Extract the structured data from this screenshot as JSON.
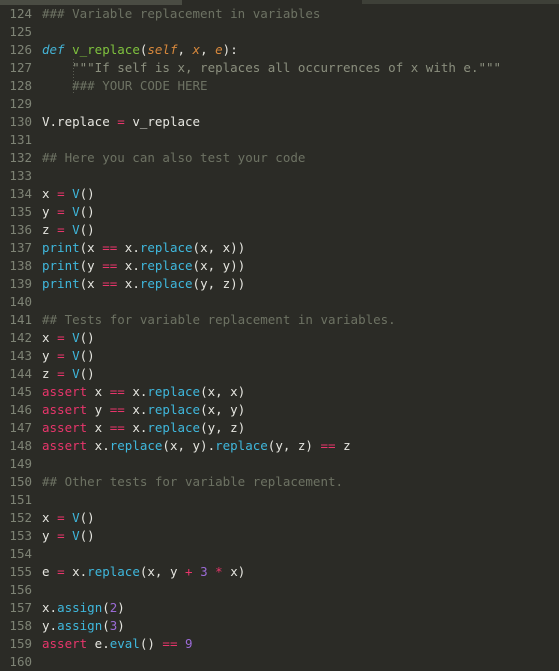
{
  "window": {
    "kind": "code-editor",
    "theme": "dark",
    "language": "python"
  },
  "colors": {
    "background": "#2b2b26",
    "gutter_text": "#7e8375",
    "foreground": "#e6e6e0",
    "comment": "#6d7263",
    "docstring": "#8b8f7e",
    "keyword": "#44b2d4",
    "function_name": "#7fc23e",
    "parameter": "#d9893c",
    "operator": "#e8356b",
    "assert_keyword": "#e8356b",
    "class_or_builtin": "#3fb8dd",
    "method": "#3fb8dd",
    "number": "#9b6bd6",
    "strip_left": "#4a4c43",
    "strip_right": "#3e4038"
  },
  "editor": {
    "first_line_number": 124,
    "last_line_number": 160,
    "lines": [
      {
        "number": "124",
        "indent_guide": false,
        "tokens": [
          {
            "text": "### Variable replacement in variables",
            "cls": "t-com"
          }
        ]
      },
      {
        "number": "125",
        "indent_guide": false,
        "tokens": []
      },
      {
        "number": "126",
        "indent_guide": false,
        "tokens": [
          {
            "text": "def",
            "cls": "t-kw"
          },
          {
            "text": " ",
            "cls": "t-punc"
          },
          {
            "text": "v_replace",
            "cls": "t-fn"
          },
          {
            "text": "(",
            "cls": "t-punc"
          },
          {
            "text": "self",
            "cls": "t-param"
          },
          {
            "text": ", ",
            "cls": "t-punc"
          },
          {
            "text": "x",
            "cls": "t-param"
          },
          {
            "text": ", ",
            "cls": "t-punc"
          },
          {
            "text": "e",
            "cls": "t-param"
          },
          {
            "text": "):",
            "cls": "t-punc"
          }
        ]
      },
      {
        "number": "127",
        "indent_guide": true,
        "tokens": [
          {
            "text": "    \"\"\"If self is x, replaces all occurrences of x with e.\"\"\"",
            "cls": "t-doc"
          }
        ]
      },
      {
        "number": "128",
        "indent_guide": true,
        "tokens": [
          {
            "text": "    ### YOUR CODE HERE",
            "cls": "t-com"
          }
        ]
      },
      {
        "number": "129",
        "indent_guide": false,
        "tokens": []
      },
      {
        "number": "130",
        "indent_guide": false,
        "tokens": [
          {
            "text": "V.replace ",
            "cls": "t-id"
          },
          {
            "text": "=",
            "cls": "t-op"
          },
          {
            "text": " v_replace",
            "cls": "t-id"
          }
        ]
      },
      {
        "number": "131",
        "indent_guide": false,
        "tokens": []
      },
      {
        "number": "132",
        "indent_guide": false,
        "tokens": [
          {
            "text": "## Here you can also test your code",
            "cls": "t-com"
          }
        ]
      },
      {
        "number": "133",
        "indent_guide": false,
        "tokens": []
      },
      {
        "number": "134",
        "indent_guide": false,
        "tokens": [
          {
            "text": "x ",
            "cls": "t-id"
          },
          {
            "text": "=",
            "cls": "t-op"
          },
          {
            "text": " ",
            "cls": "t-punc"
          },
          {
            "text": "V",
            "cls": "t-cls"
          },
          {
            "text": "()",
            "cls": "t-punc"
          }
        ]
      },
      {
        "number": "135",
        "indent_guide": false,
        "tokens": [
          {
            "text": "y ",
            "cls": "t-id"
          },
          {
            "text": "=",
            "cls": "t-op"
          },
          {
            "text": " ",
            "cls": "t-punc"
          },
          {
            "text": "V",
            "cls": "t-cls"
          },
          {
            "text": "()",
            "cls": "t-punc"
          }
        ]
      },
      {
        "number": "136",
        "indent_guide": false,
        "tokens": [
          {
            "text": "z ",
            "cls": "t-id"
          },
          {
            "text": "=",
            "cls": "t-op"
          },
          {
            "text": " ",
            "cls": "t-punc"
          },
          {
            "text": "V",
            "cls": "t-cls"
          },
          {
            "text": "()",
            "cls": "t-punc"
          }
        ]
      },
      {
        "number": "137",
        "indent_guide": false,
        "tokens": [
          {
            "text": "print",
            "cls": "t-cls"
          },
          {
            "text": "(x ",
            "cls": "t-punc"
          },
          {
            "text": "==",
            "cls": "t-op"
          },
          {
            "text": " x.",
            "cls": "t-punc"
          },
          {
            "text": "replace",
            "cls": "t-meth"
          },
          {
            "text": "(x, x))",
            "cls": "t-punc"
          }
        ]
      },
      {
        "number": "138",
        "indent_guide": false,
        "tokens": [
          {
            "text": "print",
            "cls": "t-cls"
          },
          {
            "text": "(y ",
            "cls": "t-punc"
          },
          {
            "text": "==",
            "cls": "t-op"
          },
          {
            "text": " x.",
            "cls": "t-punc"
          },
          {
            "text": "replace",
            "cls": "t-meth"
          },
          {
            "text": "(x, y))",
            "cls": "t-punc"
          }
        ]
      },
      {
        "number": "139",
        "indent_guide": false,
        "tokens": [
          {
            "text": "print",
            "cls": "t-cls"
          },
          {
            "text": "(x ",
            "cls": "t-punc"
          },
          {
            "text": "==",
            "cls": "t-op"
          },
          {
            "text": " x.",
            "cls": "t-punc"
          },
          {
            "text": "replace",
            "cls": "t-meth"
          },
          {
            "text": "(y, z))",
            "cls": "t-punc"
          }
        ]
      },
      {
        "number": "140",
        "indent_guide": false,
        "tokens": []
      },
      {
        "number": "141",
        "indent_guide": false,
        "tokens": [
          {
            "text": "## Tests for variable replacement in variables.",
            "cls": "t-com"
          }
        ]
      },
      {
        "number": "142",
        "indent_guide": false,
        "tokens": [
          {
            "text": "x ",
            "cls": "t-id"
          },
          {
            "text": "=",
            "cls": "t-op"
          },
          {
            "text": " ",
            "cls": "t-punc"
          },
          {
            "text": "V",
            "cls": "t-cls"
          },
          {
            "text": "()",
            "cls": "t-punc"
          }
        ]
      },
      {
        "number": "143",
        "indent_guide": false,
        "tokens": [
          {
            "text": "y ",
            "cls": "t-id"
          },
          {
            "text": "=",
            "cls": "t-op"
          },
          {
            "text": " ",
            "cls": "t-punc"
          },
          {
            "text": "V",
            "cls": "t-cls"
          },
          {
            "text": "()",
            "cls": "t-punc"
          }
        ]
      },
      {
        "number": "144",
        "indent_guide": false,
        "tokens": [
          {
            "text": "z ",
            "cls": "t-id"
          },
          {
            "text": "=",
            "cls": "t-op"
          },
          {
            "text": " ",
            "cls": "t-punc"
          },
          {
            "text": "V",
            "cls": "t-cls"
          },
          {
            "text": "()",
            "cls": "t-punc"
          }
        ]
      },
      {
        "number": "145",
        "indent_guide": false,
        "tokens": [
          {
            "text": "assert",
            "cls": "t-assert"
          },
          {
            "text": " x ",
            "cls": "t-punc"
          },
          {
            "text": "==",
            "cls": "t-op"
          },
          {
            "text": " x.",
            "cls": "t-punc"
          },
          {
            "text": "replace",
            "cls": "t-meth"
          },
          {
            "text": "(x, x)",
            "cls": "t-punc"
          }
        ]
      },
      {
        "number": "146",
        "indent_guide": false,
        "tokens": [
          {
            "text": "assert",
            "cls": "t-assert"
          },
          {
            "text": " y ",
            "cls": "t-punc"
          },
          {
            "text": "==",
            "cls": "t-op"
          },
          {
            "text": " x.",
            "cls": "t-punc"
          },
          {
            "text": "replace",
            "cls": "t-meth"
          },
          {
            "text": "(x, y)",
            "cls": "t-punc"
          }
        ]
      },
      {
        "number": "147",
        "indent_guide": false,
        "tokens": [
          {
            "text": "assert",
            "cls": "t-assert"
          },
          {
            "text": " x ",
            "cls": "t-punc"
          },
          {
            "text": "==",
            "cls": "t-op"
          },
          {
            "text": " x.",
            "cls": "t-punc"
          },
          {
            "text": "replace",
            "cls": "t-meth"
          },
          {
            "text": "(y, z)",
            "cls": "t-punc"
          }
        ]
      },
      {
        "number": "148",
        "indent_guide": false,
        "tokens": [
          {
            "text": "assert",
            "cls": "t-assert"
          },
          {
            "text": " x.",
            "cls": "t-punc"
          },
          {
            "text": "replace",
            "cls": "t-meth"
          },
          {
            "text": "(x, y).",
            "cls": "t-punc"
          },
          {
            "text": "replace",
            "cls": "t-meth"
          },
          {
            "text": "(y, z) ",
            "cls": "t-punc"
          },
          {
            "text": "==",
            "cls": "t-op"
          },
          {
            "text": " z",
            "cls": "t-punc"
          }
        ]
      },
      {
        "number": "149",
        "indent_guide": false,
        "tokens": []
      },
      {
        "number": "150",
        "indent_guide": false,
        "tokens": [
          {
            "text": "## Other tests for variable replacement.",
            "cls": "t-com"
          }
        ]
      },
      {
        "number": "151",
        "indent_guide": false,
        "tokens": []
      },
      {
        "number": "152",
        "indent_guide": false,
        "tokens": [
          {
            "text": "x ",
            "cls": "t-id"
          },
          {
            "text": "=",
            "cls": "t-op"
          },
          {
            "text": " ",
            "cls": "t-punc"
          },
          {
            "text": "V",
            "cls": "t-cls"
          },
          {
            "text": "()",
            "cls": "t-punc"
          }
        ]
      },
      {
        "number": "153",
        "indent_guide": false,
        "tokens": [
          {
            "text": "y ",
            "cls": "t-id"
          },
          {
            "text": "=",
            "cls": "t-op"
          },
          {
            "text": " ",
            "cls": "t-punc"
          },
          {
            "text": "V",
            "cls": "t-cls"
          },
          {
            "text": "()",
            "cls": "t-punc"
          }
        ]
      },
      {
        "number": "154",
        "indent_guide": false,
        "tokens": []
      },
      {
        "number": "155",
        "indent_guide": false,
        "tokens": [
          {
            "text": "e ",
            "cls": "t-id"
          },
          {
            "text": "=",
            "cls": "t-op"
          },
          {
            "text": " x.",
            "cls": "t-punc"
          },
          {
            "text": "replace",
            "cls": "t-meth"
          },
          {
            "text": "(x, y ",
            "cls": "t-punc"
          },
          {
            "text": "+",
            "cls": "t-op"
          },
          {
            "text": " ",
            "cls": "t-punc"
          },
          {
            "text": "3",
            "cls": "t-num"
          },
          {
            "text": " ",
            "cls": "t-punc"
          },
          {
            "text": "*",
            "cls": "t-op"
          },
          {
            "text": " x)",
            "cls": "t-punc"
          }
        ]
      },
      {
        "number": "156",
        "indent_guide": false,
        "tokens": []
      },
      {
        "number": "157",
        "indent_guide": false,
        "tokens": [
          {
            "text": "x.",
            "cls": "t-punc"
          },
          {
            "text": "assign",
            "cls": "t-meth"
          },
          {
            "text": "(",
            "cls": "t-punc"
          },
          {
            "text": "2",
            "cls": "t-num"
          },
          {
            "text": ")",
            "cls": "t-punc"
          }
        ]
      },
      {
        "number": "158",
        "indent_guide": false,
        "tokens": [
          {
            "text": "y.",
            "cls": "t-punc"
          },
          {
            "text": "assign",
            "cls": "t-meth"
          },
          {
            "text": "(",
            "cls": "t-punc"
          },
          {
            "text": "3",
            "cls": "t-num"
          },
          {
            "text": ")",
            "cls": "t-punc"
          }
        ]
      },
      {
        "number": "159",
        "indent_guide": false,
        "tokens": [
          {
            "text": "assert",
            "cls": "t-assert"
          },
          {
            "text": " e.",
            "cls": "t-punc"
          },
          {
            "text": "eval",
            "cls": "t-meth"
          },
          {
            "text": "() ",
            "cls": "t-punc"
          },
          {
            "text": "==",
            "cls": "t-op"
          },
          {
            "text": " ",
            "cls": "t-punc"
          },
          {
            "text": "9",
            "cls": "t-num"
          }
        ]
      },
      {
        "number": "160",
        "indent_guide": false,
        "tokens": []
      }
    ]
  }
}
